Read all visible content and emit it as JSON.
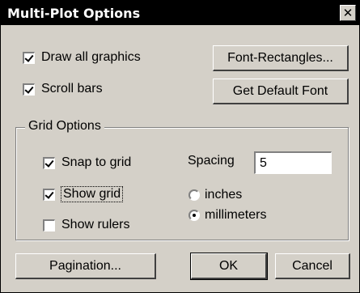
{
  "window": {
    "title": "Multi-Plot Options",
    "close_glyph": "✕"
  },
  "options": {
    "draw_all_graphics": {
      "label": "Draw all graphics",
      "checked": true
    },
    "scroll_bars": {
      "label": "Scroll bars",
      "checked": true
    }
  },
  "buttons": {
    "font_rectangles": "Font-Rectangles...",
    "get_default_font": "Get Default Font",
    "pagination": "Pagination...",
    "ok": "OK",
    "cancel": "Cancel"
  },
  "grid": {
    "group_label": "Grid Options",
    "snap_to_grid": {
      "label": "Snap to grid",
      "checked": true
    },
    "show_grid": {
      "label": "Show grid",
      "checked": true
    },
    "show_rulers": {
      "label": "Show rulers",
      "checked": false
    },
    "spacing_label": "Spacing",
    "spacing_value": "5",
    "units": [
      {
        "label": "inches",
        "selected": false
      },
      {
        "label": "millimeters",
        "selected": true
      }
    ]
  }
}
